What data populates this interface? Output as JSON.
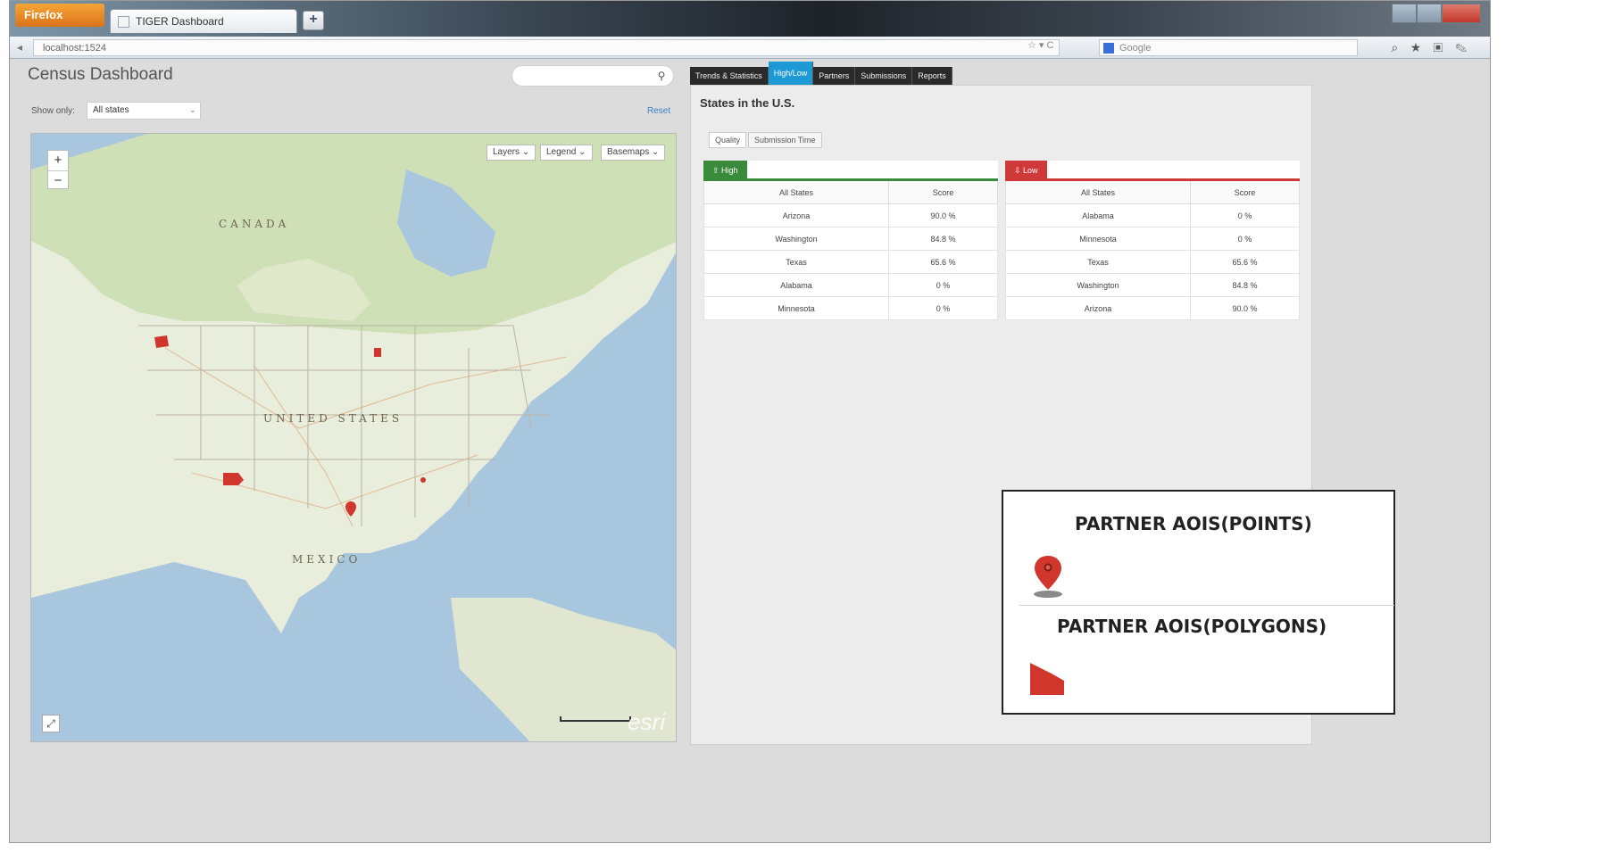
{
  "browser": {
    "app_button": "Firefox",
    "tab_title": "TIGER Dashboard",
    "new_tab": "+",
    "url": "localhost:1524",
    "search_placeholder": "Google",
    "url_tools": "☆ ▾ C"
  },
  "header": {
    "title": "Census Dashboard",
    "search_placeholder": "",
    "search_icon": "magnifier-icon"
  },
  "filter": {
    "label": "Show only:",
    "selected": "All states",
    "reset": "Reset"
  },
  "map": {
    "controls": {
      "layers": "Layers ⌄",
      "legend": "Legend ⌄",
      "basemaps": "Basemaps ⌄"
    },
    "zoom_in": "+",
    "zoom_out": "−",
    "labels": {
      "canada": "CANADA",
      "usa": "UNITED STATES",
      "mexico": "MEXICO"
    },
    "attribution": "esri",
    "colors": {
      "water": "#a9c6df",
      "land": "#e9eddb",
      "forest": "#cfdfb6",
      "marker": "#d0362b"
    }
  },
  "tabs": [
    "Trends & Statistics",
    "High/Low",
    "Partners",
    "Submissions",
    "Reports"
  ],
  "active_tab": "High/Low",
  "panel": {
    "title": "States in the U.S.",
    "subtabs": [
      "Quality",
      "Submission Time"
    ],
    "high": {
      "badge": "High",
      "color": "#3a8a3c",
      "columns": [
        "All States",
        "Score"
      ],
      "rows": [
        {
          "state": "Arizona",
          "score": "90.0 %"
        },
        {
          "state": "Washington",
          "score": "84.8 %"
        },
        {
          "state": "Texas",
          "score": "65.6 %"
        },
        {
          "state": "Alabama",
          "score": "0 %"
        },
        {
          "state": "Minnesota",
          "score": "0 %"
        }
      ]
    },
    "low": {
      "badge": "Low",
      "color": "#d0393a",
      "columns": [
        "All States",
        "Score"
      ],
      "rows": [
        {
          "state": "Alabama",
          "score": "0 %"
        },
        {
          "state": "Minnesota",
          "score": "0 %"
        },
        {
          "state": "Texas",
          "score": "65.6 %"
        },
        {
          "state": "Washington",
          "score": "84.8 %"
        },
        {
          "state": "Arizona",
          "score": "90.0 %"
        }
      ]
    }
  },
  "legend": {
    "points_title": "PARTNER AOIS(POINTS)",
    "polygons_title": "PARTNER AOIS(POLYGONS)",
    "points_icon": "map-pin-icon",
    "polygons_icon": "polygon-icon"
  }
}
